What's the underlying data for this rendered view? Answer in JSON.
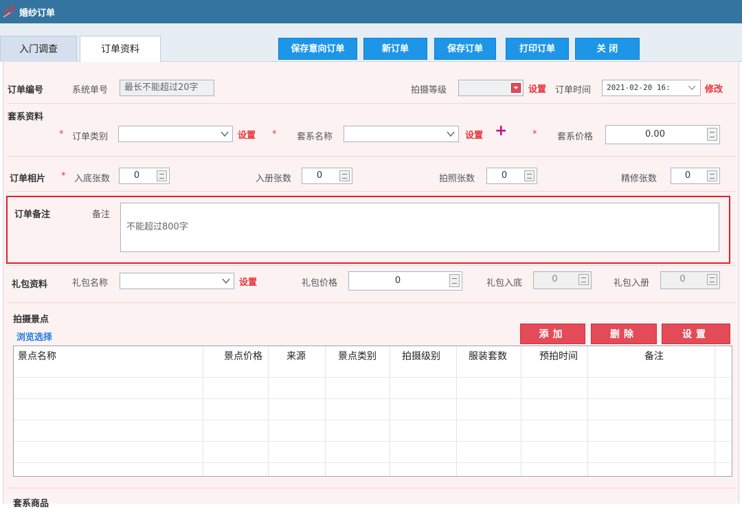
{
  "window": {
    "title": "婚纱订单"
  },
  "tabs": [
    {
      "label": "入门调查"
    },
    {
      "label": "订单资料"
    }
  ],
  "toolbar": {
    "save_intent": "保存意向订单",
    "new_order": "新订单",
    "save_order": "保存订单",
    "print_order": "打印订单",
    "close": "关 闭"
  },
  "order_no": {
    "section": "订单编号",
    "sys_label": "系统单号",
    "sys_placeholder": "最长不能超过20字",
    "grade_label": "拍摄等级",
    "grade_set": "设置",
    "time_label": "订单时间",
    "time_value": "2021-02-20 16:",
    "modify": "修改"
  },
  "package": {
    "section": "套系资料",
    "req": "*",
    "type_label": "订单类别",
    "type_set": "设置",
    "name_label": "套系名称",
    "name_set": "设置",
    "plus": "+",
    "price_label": "套系价格",
    "price_value": "0.00"
  },
  "photos": {
    "section": "订单相片",
    "req": "*",
    "base_label": "入底张数",
    "base_value": "0",
    "album_label": "入册张数",
    "album_value": "0",
    "shot_label": "拍照张数",
    "shot_value": "0",
    "retouch_label": "精修张数",
    "retouch_value": "0"
  },
  "remark": {
    "section": "订单备注",
    "label": "备注",
    "placeholder": "不能超过800字"
  },
  "gift": {
    "section": "礼包资料",
    "name_label": "礼包名称",
    "name_set": "设置",
    "price_label": "礼包价格",
    "price_value": "0",
    "base_label": "礼包入底",
    "base_value": "0",
    "album_label": "礼包入册",
    "album_value": "0"
  },
  "scenes": {
    "section": "拍摄景点",
    "browse": "浏览选择",
    "add": "添加",
    "delete": "删除",
    "setup": "设置",
    "columns": [
      "景点名称",
      "景点价格",
      "来源",
      "景点类别",
      "拍摄级别",
      "服装套数",
      "预拍时间",
      "备注"
    ]
  },
  "goods": {
    "section": "套系商品"
  },
  "colors": {
    "titlebar": "#3474a0",
    "toolbar_button": "#1d96e8",
    "accent_red": "#e34b58",
    "highlight": "#e3202a"
  }
}
